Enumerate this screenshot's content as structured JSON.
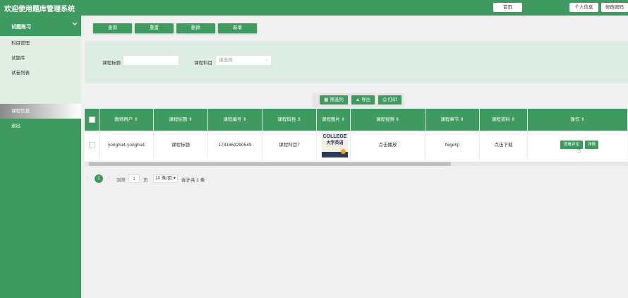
{
  "header": {
    "title": "欢迎使用题库管理系统",
    "home": "首页",
    "profile": "个人信息",
    "change_password": "修改密码"
  },
  "sidebar": {
    "group": "试题练习",
    "sub_items": [
      "科目管理",
      "试题库",
      "试卷列表"
    ],
    "items": [
      "课程信息",
      "退出"
    ]
  },
  "actions": [
    "查询",
    "重置",
    "删除",
    "新增"
  ],
  "search": {
    "title_label": "课程标题",
    "title_value": "",
    "subject_label": "课程科目",
    "subject_placeholder": "请选择"
  },
  "toolbar2": {
    "filter": "筛选列",
    "export": "导出",
    "print": "打印"
  },
  "table": {
    "headers": [
      "教师用户",
      "课程标题",
      "课程编号",
      "课程科目",
      "课程图片",
      "课程视频",
      "课程章节",
      "课程资料",
      "操作"
    ],
    "rows": [
      {
        "teacher": "yonghu4-yonghu4",
        "title": "课程标题",
        "code": "1741863290549",
        "subject": "课程科目7",
        "video": "点击播放",
        "chapter": "fwgehjt",
        "material": "点击下载",
        "op_view": "查看评论",
        "op_detail": "详情"
      }
    ]
  },
  "thumb": {
    "line1": "COLLEGE",
    "line2": "大学英语"
  },
  "pager": {
    "current": "1",
    "goto_label": "到第",
    "page_input": "1",
    "page_suffix": "页",
    "page_size": "10 条/页",
    "total": "合计共 1 条"
  },
  "colors": {
    "primary": "#3f9a5f",
    "panel": "#deede3"
  }
}
